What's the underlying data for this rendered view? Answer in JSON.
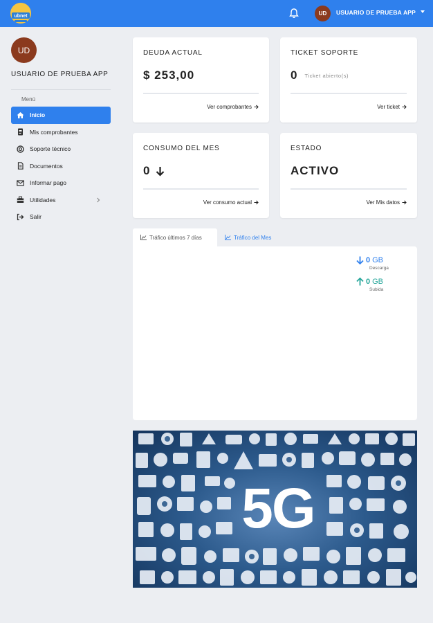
{
  "brand": {
    "logo_text": "ubnet",
    "accent": "#2f80ed"
  },
  "header": {
    "avatar_initials": "UD",
    "user_name": "USUARIO DE PRUEBA APP"
  },
  "sidebar": {
    "avatar_initials": "UD",
    "user_name": "USUARIO DE PRUEBA APP",
    "menu_title": "Menú",
    "items": [
      {
        "label": "Inicio",
        "icon": "home-icon",
        "active": true
      },
      {
        "label": "Mis comprobantes",
        "icon": "receipt-icon"
      },
      {
        "label": "Soporte técnico",
        "icon": "support-icon"
      },
      {
        "label": "Documentos",
        "icon": "document-icon"
      },
      {
        "label": "Informar pago",
        "icon": "envelope-icon"
      },
      {
        "label": "Utilidades",
        "icon": "toolbox-icon",
        "has_submenu": true
      },
      {
        "label": "Salir",
        "icon": "logout-icon"
      }
    ]
  },
  "cards": {
    "deuda": {
      "title": "DEUDA ACTUAL",
      "value": "$ 253,00",
      "link": "Ver comprobantes"
    },
    "ticket": {
      "title": "TICKET SOPORTE",
      "value": "0",
      "sub": "Ticket abierto(s)",
      "link": "Ver ticket"
    },
    "consumo": {
      "title": "CONSUMO DEL MES",
      "value": "0",
      "link": "Ver consumo actual"
    },
    "estado": {
      "title": "ESTADO",
      "value": "ACTIVO",
      "link": "Ver Mis datos"
    }
  },
  "traffic": {
    "tabs": [
      {
        "label": "Tráfico últimos 7 días",
        "active": true
      },
      {
        "label": "Tráfico del Mes",
        "active": false
      }
    ],
    "download": {
      "value": "0",
      "unit": "GB",
      "label": "Descarga",
      "color": "#2f80ed"
    },
    "upload": {
      "value": "0",
      "unit": "GB",
      "label": "Subida",
      "color": "#26a69a"
    }
  },
  "banner": {
    "text": "5G"
  }
}
